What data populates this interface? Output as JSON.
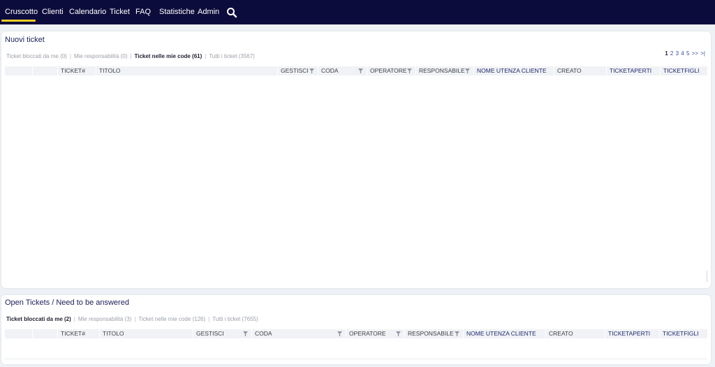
{
  "nav": {
    "items": [
      "Cruscotto",
      "Clienti",
      "Calendario",
      "Ticket",
      "FAQ",
      "Statistiche",
      "Admin"
    ],
    "active": "Cruscotto",
    "search_icon": "search-icon",
    "accent": "#f5d028",
    "background": "#0c0c3c"
  },
  "widget1": {
    "title": "Nuovi ticket",
    "filters": [
      {
        "label": "Ticket bloccati da me (0)",
        "active": false
      },
      {
        "label": "Mie responsabilità (0)",
        "active": false
      },
      {
        "label": "Ticket nelle mie code (61)",
        "active": true
      },
      {
        "label": "Tutti i ticket (3567)",
        "active": false
      }
    ],
    "pager": {
      "pages": [
        "1",
        "2",
        "3",
        "4",
        "5"
      ],
      "current": "1",
      "next": ">>",
      "last": ">|"
    },
    "columns": [
      "TICKET#",
      "TITOLO",
      "GESTISCI",
      "CODA",
      "OPERATORE",
      "RESPONSABILE",
      "NOME UTENZA CLIENTE",
      "CREATO",
      "TICKETAPERTI",
      "TICKETFIGLI"
    ]
  },
  "widget2": {
    "title": "Open Tickets / Need to be answered",
    "filters": [
      {
        "label": "Ticket bloccati da me (2)",
        "active": true
      },
      {
        "label": "Mie responsabilità (3)",
        "active": false
      },
      {
        "label": "Ticket nelle mie code (126)",
        "active": false
      },
      {
        "label": "Tutti i ticket (7655)",
        "active": false
      }
    ],
    "columns": [
      "TICKET#",
      "TITOLO",
      "GESTISCI",
      "CODA",
      "OPERATORE",
      "RESPONSABILE",
      "NOME UTENZA CLIENTE",
      "CREATO",
      "TICKETAPERTI",
      "TICKETFIGLI"
    ]
  }
}
